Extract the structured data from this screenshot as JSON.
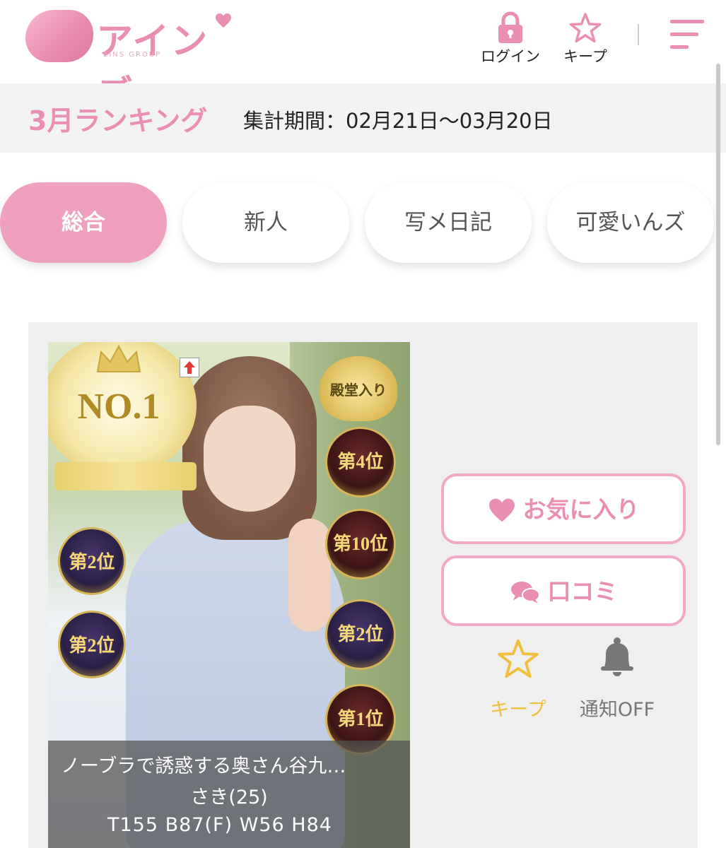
{
  "header": {
    "logo_text": "アインズ",
    "logo_sub": "EINS GROUP",
    "login_label": "ログイン",
    "keep_label": "キープ"
  },
  "ranking": {
    "title": "3月ランキング",
    "period": "集計期間：02月21日〜03月20日"
  },
  "tabs": [
    {
      "label": "総合",
      "active": true
    },
    {
      "label": "新人",
      "active": false
    },
    {
      "label": "写メ日記",
      "active": false
    },
    {
      "label": "可愛いんズ",
      "active": false
    }
  ],
  "card": {
    "badges": {
      "no1": "NO.1",
      "rank_4": "第4位",
      "rank_10": "第10位",
      "rank_2a": "第2位",
      "rank_2b": "第2位",
      "rank_2c": "第2位",
      "rank_1": "第1位",
      "hall": "殿堂入り"
    },
    "caption": {
      "title": "ノーブラで誘惑する奥さん谷九…",
      "name": "さき(25)",
      "sizes": "T155 B87(F) W56 H84"
    },
    "favorite_label": "お気に入り",
    "review_label": "口コミ",
    "keep_label": "キープ",
    "notify_label": "通知OFF"
  },
  "colors": {
    "accent_pink": "#ea8fb3",
    "tab_active": "#f0a0bf",
    "keep_yellow": "#f0bf3c",
    "band_gray": "#f2f2f2"
  }
}
